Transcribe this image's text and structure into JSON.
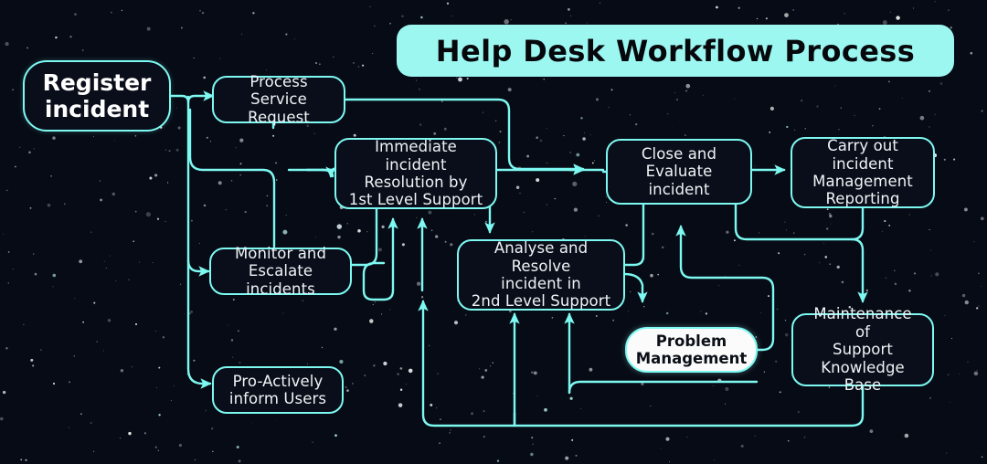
{
  "page": {
    "title": "Help Desk Workflow Process",
    "background_color": "#070b15",
    "accent_color": "#7df9f2",
    "title_bg_color": "#9cf7f1",
    "node_fill_color": "#0a0e1a",
    "node_text_color": "#eef4f6"
  },
  "nodes": [
    {
      "id": "register",
      "label": "Register\nincident",
      "line1": "Register",
      "line2": "incident",
      "line3": "",
      "style": "start"
    },
    {
      "id": "process",
      "label": "Process Service Request",
      "line1": "Process Service",
      "line2": "Request",
      "line3": "",
      "style": "plain"
    },
    {
      "id": "immediate",
      "label": "Immediate incident Resolution by 1st Level Support",
      "line1": "Immediate incident",
      "line2": "Resolution by",
      "line3": "1st Level Support",
      "style": "plain"
    },
    {
      "id": "monitor",
      "label": "Monitor and Escalate incidents",
      "line1": "Monitor and",
      "line2": "Escalate incidents",
      "line3": "",
      "style": "plain"
    },
    {
      "id": "proactive",
      "label": "Pro-Actively inform Users",
      "line1": "Pro-Actively",
      "line2": "inform Users",
      "line3": "",
      "style": "plain"
    },
    {
      "id": "analyse",
      "label": "Analyse and Resolve incident in 2nd Level Support",
      "line1": "Analyse and Resolve",
      "line2": "incident in",
      "line3": "2nd Level Support",
      "style": "plain"
    },
    {
      "id": "close",
      "label": "Close and Evaluate incident",
      "line1": "Close and",
      "line2": "Evaluate incident",
      "line3": "",
      "style": "plain"
    },
    {
      "id": "reporting",
      "label": "Carry out incident Management Reporting",
      "line1": "Carry out incident",
      "line2": "Management",
      "line3": "Reporting",
      "style": "plain"
    },
    {
      "id": "problem",
      "label": "Problem Management",
      "line1": "Problem",
      "line2": "Management",
      "line3": "",
      "style": "light"
    },
    {
      "id": "knowledge",
      "label": "Maintenance of Support Knowledge Base",
      "line1": "Maintenance of",
      "line2": "Support",
      "line3": "Knowledge Base",
      "style": "plain"
    }
  ],
  "edges": [
    {
      "from": "register",
      "to": "process",
      "kind": "arrow"
    },
    {
      "from": "register",
      "to": "immediate",
      "kind": "arrow"
    },
    {
      "from": "register",
      "to": "monitor",
      "kind": "arrow"
    },
    {
      "from": "register",
      "to": "proactive",
      "kind": "arrow"
    },
    {
      "from": "process",
      "to": "close",
      "kind": "arrow"
    },
    {
      "from": "immediate",
      "to": "close",
      "kind": "arrow"
    },
    {
      "from": "immediate",
      "to": "analyse",
      "kind": "arrow"
    },
    {
      "from": "monitor",
      "to": "immediate",
      "kind": "arrow"
    },
    {
      "from": "monitor",
      "to": "process",
      "kind": "arrow"
    },
    {
      "from": "analyse",
      "to": "close",
      "kind": "arrow"
    },
    {
      "from": "analyse",
      "to": "problem",
      "kind": "arrow"
    },
    {
      "from": "close",
      "to": "reporting",
      "kind": "arrow"
    },
    {
      "from": "close",
      "to": "knowledge",
      "kind": "arrow"
    },
    {
      "from": "problem",
      "to": "close",
      "kind": "arrow"
    },
    {
      "from": "knowledge",
      "to": "analyse",
      "kind": "arrow"
    },
    {
      "from": "reporting",
      "to": "analyse",
      "kind": "arrow"
    }
  ]
}
